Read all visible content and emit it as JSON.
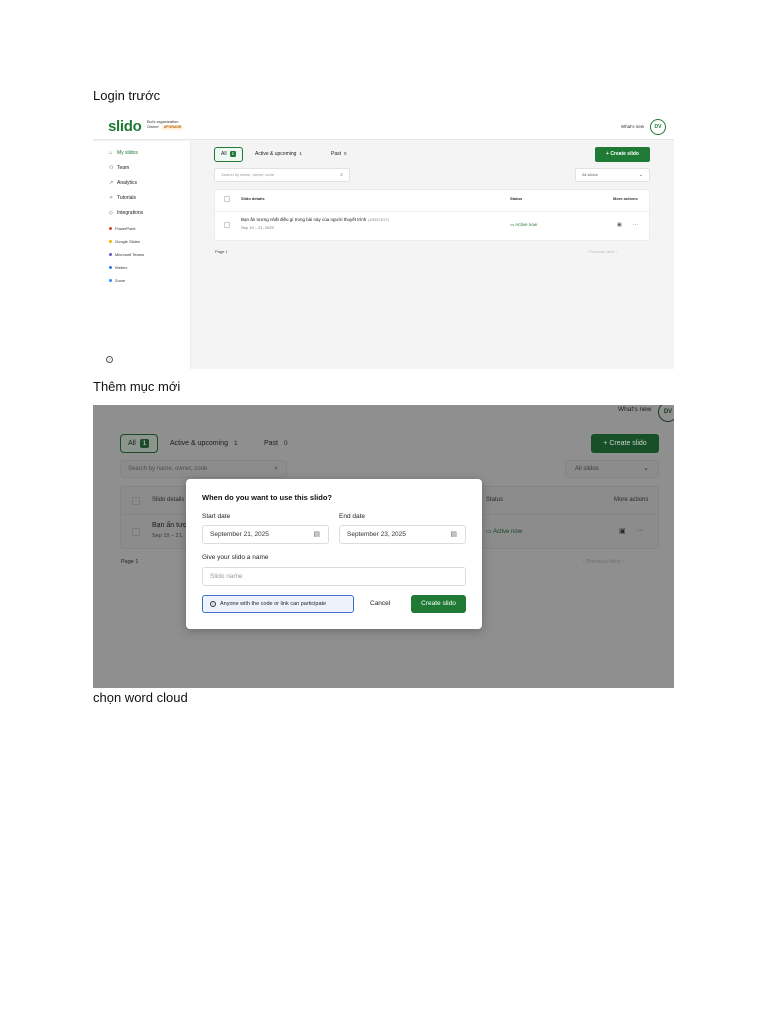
{
  "captions": {
    "first": "Login trước",
    "second": "Thêm mục mới",
    "third": "chọn word cloud"
  },
  "shot1": {
    "logo": "slido",
    "org_name": "Bui's organization",
    "org_role": "Owner",
    "upgrade": "UPGRADE",
    "whats_new": "What's new",
    "avatar": "DV",
    "nav": [
      "My slidos",
      "Team",
      "Analytics",
      "Tutorials",
      "Integrations"
    ],
    "integrations": [
      "PowerPoint",
      "Google Slides",
      "Microsoft Teams",
      "Webex",
      "Zoom"
    ],
    "tabs": {
      "all_label": "All",
      "all_count": "1",
      "active_label": "Active & upcoming",
      "active_count": "1",
      "past_label": "Past",
      "past_count": "0"
    },
    "create_button": "+ Create slido",
    "search_placeholder": "Search by name, owner, code",
    "filter": "All slidos",
    "table": {
      "col_details": "Slido details",
      "col_status": "Status",
      "col_actions": "More actions",
      "row_title": "Bạn ấn tượng nhất điều gì trong bài này của người thuyết trình",
      "row_code": "(#3357617)",
      "row_date": "Sep 19 – 21, 2025",
      "row_status": "Active now"
    },
    "page_label": "Page 1",
    "pager": "‹ Previous   Next ›"
  },
  "shot2": {
    "whats_new": "What's new",
    "avatar": "DV",
    "tabs": {
      "all_label": "All",
      "all_count": "1",
      "active_label": "Active & upcoming",
      "active_count": "1",
      "past_label": "Past",
      "past_count": "0"
    },
    "create_button": "+ Create slido",
    "search_placeholder": "Search by name, owner, code",
    "filter": "All slidos",
    "table": {
      "col_details": "Slido details",
      "col_status": "Status",
      "col_actions": "More actions",
      "row_title": "Bạn ấn tượ",
      "row_date": "Sep 19 – 21,",
      "row_status": "Active now"
    },
    "page_label": "Page 1",
    "pager": "‹ Previous   Next ›",
    "modal": {
      "title": "When do you want to use this slido?",
      "start_label": "Start date",
      "start_value": "September 21, 2025",
      "end_label": "End date",
      "end_value": "September 23, 2025",
      "name_label": "Give your slido a name",
      "name_placeholder": "Slido name",
      "info": "Anyone with the code or link can participate",
      "cancel": "Cancel",
      "create": "Create slido"
    }
  },
  "colors": {
    "brand_green": "#1f7a36",
    "info_blue": "#3b6fc9"
  }
}
